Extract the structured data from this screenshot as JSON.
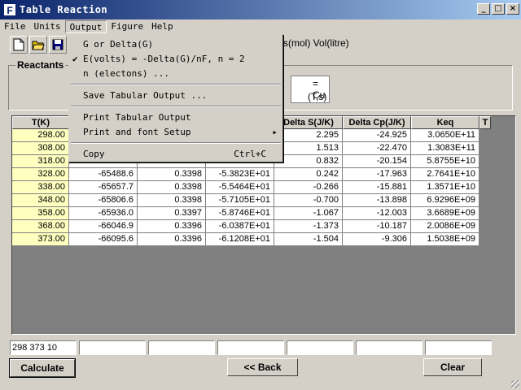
{
  "window": {
    "title": "Table Reaction",
    "icon": "F"
  },
  "menu": [
    "File",
    "Units",
    "Output",
    "Figure",
    "Help"
  ],
  "behind_text": "ss(mol)  Vol(litre)",
  "reactants": {
    "label": "Reactants",
    "cu_line1": "= Cu",
    "cu_line2": "(T,s)"
  },
  "columns": [
    "T(K)",
    "",
    "",
    "",
    "Delta S(J/K)",
    "Delta Cp(J/K)",
    "Keq",
    "T"
  ],
  "rows": [
    [
      "298.00",
      "",
      "",
      "",
      "2.295",
      "-24.925",
      "3.0650E+11"
    ],
    [
      "308.00",
      "",
      "",
      "",
      "1.513",
      "-22.470",
      "1.3083E+11"
    ],
    [
      "318.00",
      "",
      "",
      "",
      "0.832",
      "-20.154",
      "5.8755E+10"
    ],
    [
      "328.00",
      "-65488.6",
      "0.3398",
      "-5.3823E+01",
      "0.242",
      "-17.963",
      "2.7641E+10"
    ],
    [
      "338.00",
      "-65657.7",
      "0.3398",
      "-5.5464E+01",
      "-0.266",
      "-15.881",
      "1.3571E+10"
    ],
    [
      "348.00",
      "-65806.6",
      "0.3398",
      "-5.7105E+01",
      "-0.700",
      "-13.898",
      "6.9296E+09"
    ],
    [
      "358.00",
      "-65936.0",
      "0.3397",
      "-5.8746E+01",
      "-1.067",
      "-12.003",
      "3.6689E+09"
    ],
    [
      "368.00",
      "-66046.9",
      "0.3396",
      "-6.0387E+01",
      "-1.373",
      "-10.187",
      "2.0086E+09"
    ],
    [
      "373.00",
      "-66095.6",
      "0.3396",
      "-6.1208E+01",
      "-1.504",
      "-9.306",
      "1.5038E+09"
    ]
  ],
  "inputs": [
    "298 373 10",
    "",
    "",
    "",
    "",
    "",
    ""
  ],
  "buttons": {
    "calculate": "Calculate",
    "back": "<< Back",
    "clear": "Clear"
  },
  "dropdown": {
    "items": [
      "G or Delta(G)",
      "E(volts) = -Delta(G)/nF, n = 2",
      "n (electons) ...",
      "Save Tabular Output ...",
      "Print Tabular Output",
      "Print and font Setup",
      "Copy"
    ],
    "copy_shortcut": "Ctrl+C"
  }
}
